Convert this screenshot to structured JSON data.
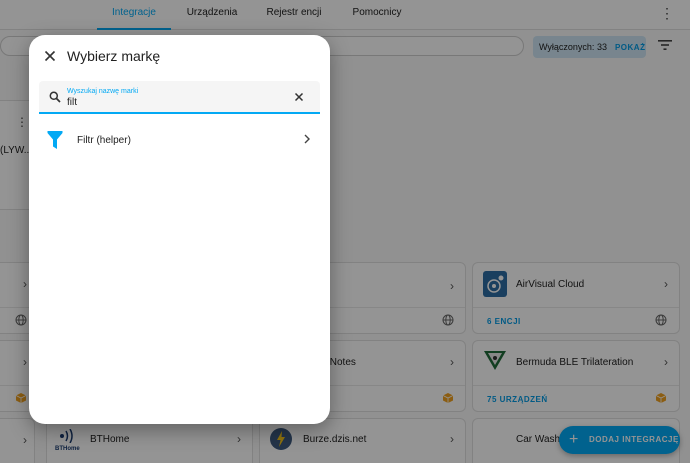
{
  "tabs": [
    {
      "label": "Integracje",
      "active": true
    },
    {
      "label": "Urządzenia",
      "active": false
    },
    {
      "label": "Rejestr encji",
      "active": false
    },
    {
      "label": "Pomocnicy",
      "active": false
    }
  ],
  "toolbar": {
    "disabled_text": "Wyłączonych: 33",
    "show_label": "POKAŻ"
  },
  "ignored": {
    "truncated_name": "(LYW..."
  },
  "cards": [
    {
      "title": "AirVisual Cloud",
      "link": "6 ENCJI"
    },
    {
      "title": "y Notes",
      "link": ""
    },
    {
      "title": "Bermuda BLE Trilateration",
      "link": "75 URZĄDZEŃ"
    },
    {
      "title": "BTHome",
      "link": ""
    },
    {
      "title": "Burze.dzis.net",
      "link": ""
    },
    {
      "title": "Car Wash",
      "link": ""
    }
  ],
  "icons": {
    "bthome_label": "BTHome"
  },
  "fab": {
    "label": "DODAJ INTEGRACJĘ"
  },
  "dialog": {
    "title": "Wybierz markę",
    "search": {
      "label": "Wyszukaj nazwę marki",
      "value": "filt"
    },
    "results": [
      {
        "label": "Filtr (helper)"
      }
    ]
  },
  "colors": {
    "accent": "#03a9f4",
    "scrim": "rgba(0,0,0,0.42)",
    "warning_icon": "#f0a020"
  }
}
